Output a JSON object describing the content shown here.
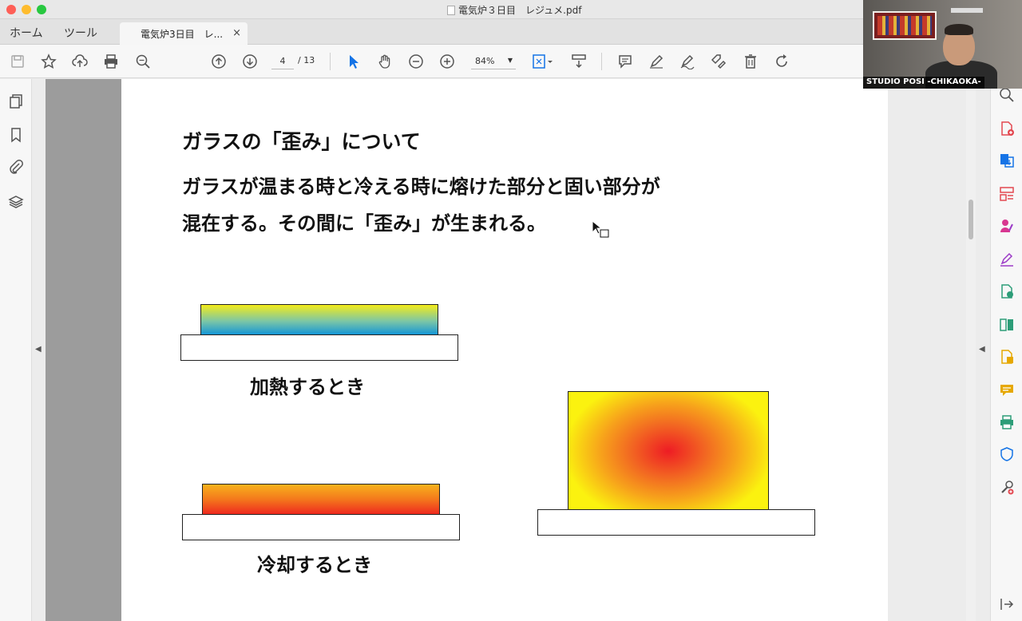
{
  "window": {
    "title": "電気炉３日目　レジュメ.pdf"
  },
  "menu": {
    "home": "ホーム",
    "tools": "ツール"
  },
  "tab": {
    "label": "電気炉3日目　レ...",
    "close": "×"
  },
  "toolbar": {
    "page_current": "4",
    "page_total": "/ 13",
    "zoom": "84%"
  },
  "document": {
    "heading": "ガラスの「歪み」について",
    "line1": "ガラスが温まる時と冷える時に熔けた部分と固い部分が",
    "line2": "混在する。その間に「歪み」が生まれる。",
    "caption_heating": "加熱するとき",
    "caption_cooling": "冷却するとき"
  },
  "webcam": {
    "label": "STUDIO POSI -CHIKAOKA-"
  },
  "colors": {
    "accent": "#1473e6",
    "tool_red": "#e34850",
    "tool_blue": "#1473e6",
    "tool_pink": "#d83790",
    "tool_purple": "#9c3bc7",
    "tool_green": "#2d9d78",
    "tool_yellow": "#e6a800"
  }
}
